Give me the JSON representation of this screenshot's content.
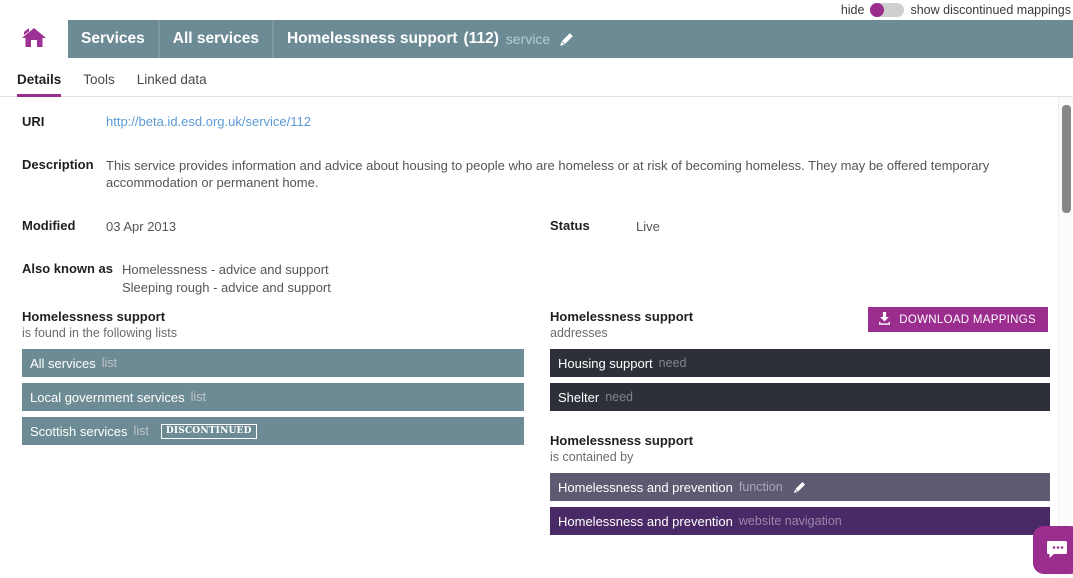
{
  "toggle": {
    "left_label": "hide",
    "right_label": "show discontinued mappings",
    "state": "hide",
    "accent_color": "#9b2d8f"
  },
  "navbar": {
    "home_icon": "home-icon",
    "crumbs": [
      {
        "label": "Services"
      },
      {
        "label": "All services"
      }
    ],
    "current": {
      "label": "Homelessness support",
      "id": "(112)",
      "type": "service",
      "edit_icon": "pencil-icon"
    },
    "background_color": "#6d8b94"
  },
  "tabs": [
    {
      "label": "Details",
      "active": true
    },
    {
      "label": "Tools",
      "active": false
    },
    {
      "label": "Linked data",
      "active": false
    }
  ],
  "details": {
    "uri_label": "URI",
    "uri_value": "http://beta.id.esd.org.uk/service/112",
    "description_label": "Description",
    "description_value": "This service provides information and advice about housing to people who are homeless or at risk of becoming homeless. They may be offered temporary accommodation or permanent home.",
    "modified_label": "Modified",
    "modified_value": "03 Apr 2013",
    "status_label": "Status",
    "status_value": "Live",
    "also_known_as_label": "Also known as",
    "also_known_as_values": [
      "Homelessness - advice and support",
      "Sleeping rough - advice and support"
    ]
  },
  "panels": {
    "left": [
      {
        "title": "Homelessness support",
        "subtitle": "is found in the following lists",
        "items": [
          {
            "name": "All services",
            "type": "list",
            "style": "teal",
            "badge": null,
            "edit_icon": false
          },
          {
            "name": "Local government services",
            "type": "list",
            "style": "teal",
            "badge": null,
            "edit_icon": false
          },
          {
            "name": "Scottish services",
            "type": "list",
            "style": "teal",
            "badge": "DISCONTINUED",
            "edit_icon": false
          }
        ]
      }
    ],
    "right": [
      {
        "title": "Homelessness support",
        "subtitle": "addresses",
        "download_button": "DOWNLOAD MAPPINGS",
        "items": [
          {
            "name": "Housing support",
            "type": "need",
            "style": "dark",
            "badge": null,
            "edit_icon": false
          },
          {
            "name": "Shelter",
            "type": "need",
            "style": "dark",
            "badge": null,
            "edit_icon": false
          }
        ]
      },
      {
        "title": "Homelessness support",
        "subtitle": "is contained by",
        "download_button": null,
        "items": [
          {
            "name": "Homelessness and prevention",
            "type": "function",
            "style": "grayviolet",
            "badge": null,
            "edit_icon": true
          },
          {
            "name": "Homelessness and prevention",
            "type": "website navigation",
            "style": "deeppurple",
            "badge": null,
            "edit_icon": false
          }
        ]
      }
    ]
  },
  "chat_widget": {
    "icon": "chat-bubble-icon",
    "color": "#9b2d8f"
  }
}
